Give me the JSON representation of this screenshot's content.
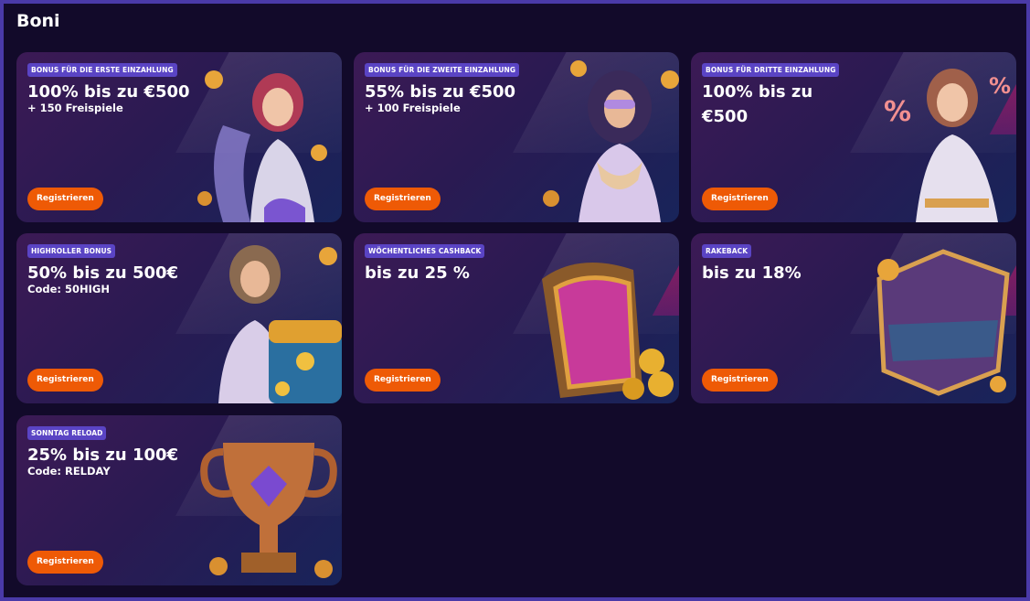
{
  "page": {
    "title": "Boni"
  },
  "cards": [
    {
      "badge": "BONUS FÜR DIE ERSTE EINZAHLUNG",
      "headline": "100% bis zu €500",
      "sub": "+ 150 Freispiele",
      "button": "Registrieren",
      "art": "harp-goddess-icon"
    },
    {
      "badge": "BONUS FÜR DIE ZWEITE EINZAHLUNG",
      "headline": "55% bis zu €500",
      "sub": "+ 100 Freispiele",
      "button": "Registrieren",
      "art": "sunglasses-goddess-icon"
    },
    {
      "badge": "BONUS FÜR DRITTE EINZAHLUNG",
      "headline": "100% bis zu",
      "headline2": "€500",
      "button": "Registrieren",
      "art": "percent-goddess-icon"
    },
    {
      "badge": "HIGHROLLER BONUS",
      "headline": "50% bis zu 500€",
      "sub": "Code: 50HIGH",
      "button": "Registrieren",
      "art": "treasure-chest-icon"
    },
    {
      "badge": "WÖCHENTLICHES CASHBACK",
      "headline": "bis zu 25 %",
      "button": "Registrieren",
      "art": "cashback-harp-icon"
    },
    {
      "badge": "RAKEBACK",
      "headline": "bis zu 18%",
      "button": "Registrieren",
      "art": "rakeback-emblem-icon"
    },
    {
      "badge": "SONNTAG RELOAD",
      "headline": "25% bis zu 100€",
      "sub": "Code: RELDAY",
      "button": "Registrieren",
      "art": "trophy-icon"
    }
  ],
  "colors": {
    "badge": "#5a44c4",
    "button": "#ee5a06",
    "background": "#120a2a",
    "border": "#4a3aa8"
  }
}
